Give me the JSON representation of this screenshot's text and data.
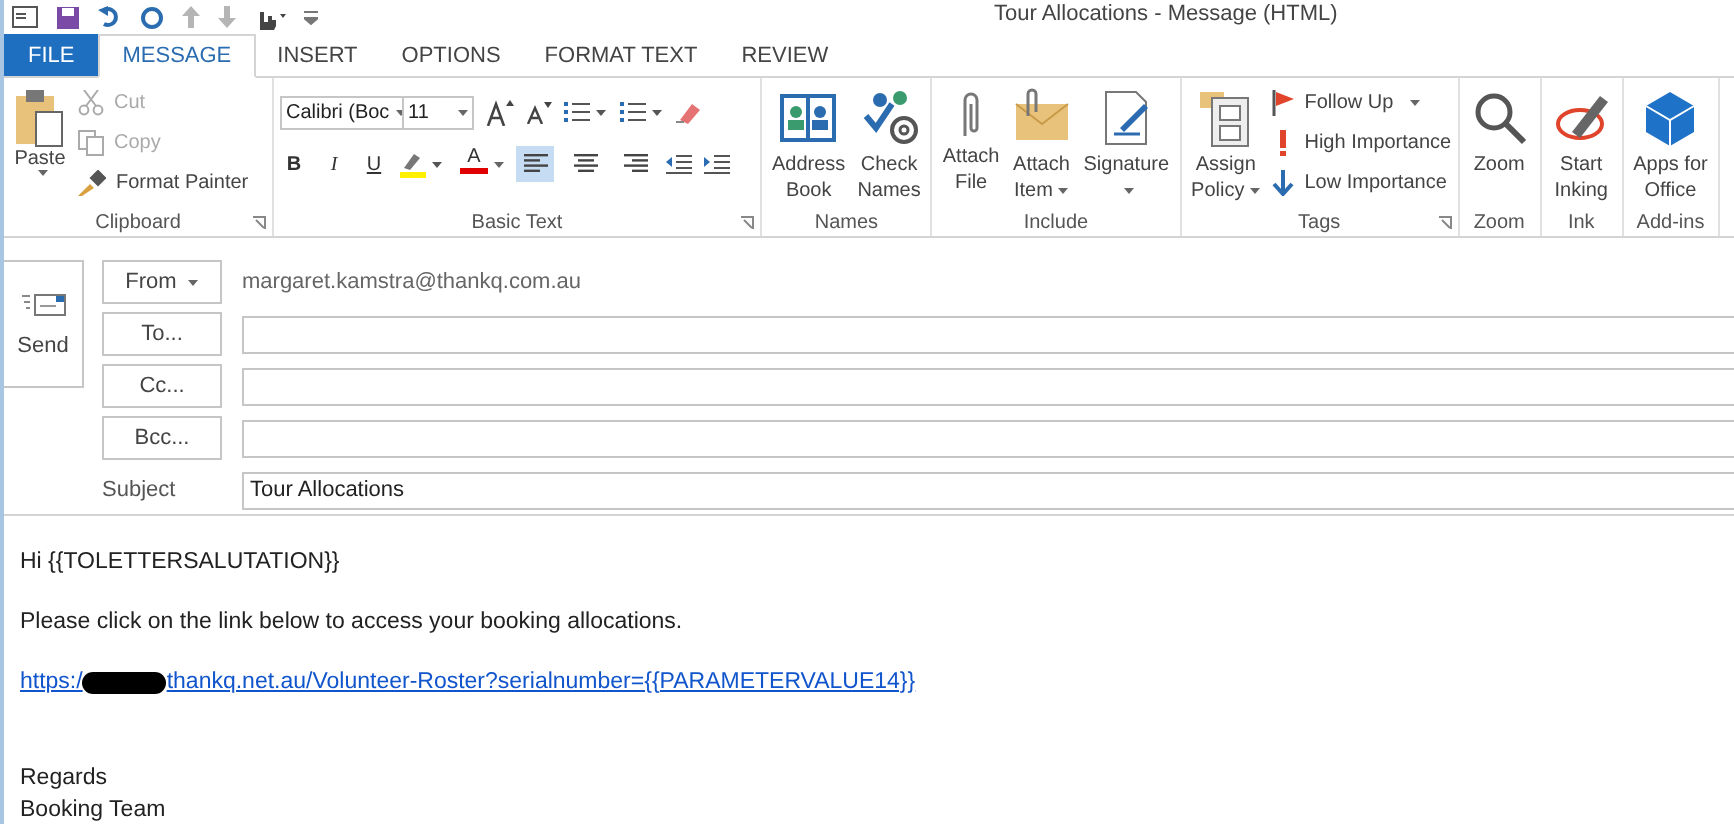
{
  "window": {
    "title": "Tour Allocations - Message (HTML)"
  },
  "tabs": [
    {
      "label": "FILE",
      "kind": "file",
      "selected": false
    },
    {
      "label": "MESSAGE",
      "kind": "tab",
      "selected": true
    },
    {
      "label": "INSERT",
      "kind": "tab",
      "selected": false
    },
    {
      "label": "OPTIONS",
      "kind": "tab",
      "selected": false
    },
    {
      "label": "FORMAT TEXT",
      "kind": "tab",
      "selected": false
    },
    {
      "label": "REVIEW",
      "kind": "tab",
      "selected": false
    }
  ],
  "ribbon": {
    "clipboard": {
      "label": "Clipboard",
      "paste": "Paste",
      "items": [
        {
          "label": "Cut",
          "disabled": true
        },
        {
          "label": "Copy",
          "disabled": true
        },
        {
          "label": "Format Painter",
          "disabled": false
        }
      ]
    },
    "basic_text": {
      "label": "Basic Text",
      "font": "Calibri (Boc",
      "size": "11",
      "bold": "B",
      "italic": "I",
      "underline": "U",
      "font_color": "A",
      "align": [
        {
          "selected": true
        },
        {
          "selected": false
        },
        {
          "selected": false
        }
      ]
    },
    "groups": [
      {
        "label": "Names",
        "buttons": [
          {
            "label": "Address\nBook",
            "caret": false
          },
          {
            "label": "Check\nNames",
            "caret": false
          }
        ]
      },
      {
        "label": "Include",
        "buttons": [
          {
            "label": "Attach\nFile",
            "caret": false
          },
          {
            "label": "Attach\nItem",
            "caret": true
          },
          {
            "label": "Signature",
            "caret": true
          }
        ]
      }
    ],
    "tags": {
      "label": "Tags",
      "policy": {
        "label": "Assign\nPolicy",
        "caret": true
      },
      "items": [
        {
          "label": "Follow Up",
          "caret": true
        },
        {
          "label": "High Importance",
          "caret": false
        },
        {
          "label": "Low Importance",
          "caret": false
        }
      ]
    },
    "tail": [
      {
        "label": "Zoom",
        "buttons": [
          {
            "label": "Zoom",
            "caret": false
          }
        ]
      },
      {
        "label": "Ink",
        "buttons": [
          {
            "label": "Start\nInking",
            "caret": false
          }
        ]
      },
      {
        "label": "Add-ins",
        "buttons": [
          {
            "label": "Apps for\nOffice",
            "caret": false
          }
        ]
      }
    ]
  },
  "compose": {
    "send": "Send",
    "from": {
      "label": "From",
      "value": "margaret.kamstra@thankq.com.au"
    },
    "recipients": [
      {
        "label": "To..."
      },
      {
        "label": "Cc..."
      },
      {
        "label": "Bcc..."
      }
    ],
    "subject": {
      "label": "Subject",
      "value": "Tour Allocations"
    }
  },
  "body": [
    {
      "kind": "text",
      "text": "Hi {{TOLETTERSALUTATION}}"
    },
    {
      "kind": "text",
      "text": "Please click on the link below to access your booking allocations."
    },
    {
      "kind": "link",
      "before": "https:/",
      "after": "thankq.net.au/Volunteer-Roster?serialnumber={{PARAMETERVALUE14}}",
      "redacted": true
    },
    {
      "kind": "closing",
      "lines": [
        "Regards",
        "Booking Team"
      ]
    }
  ]
}
